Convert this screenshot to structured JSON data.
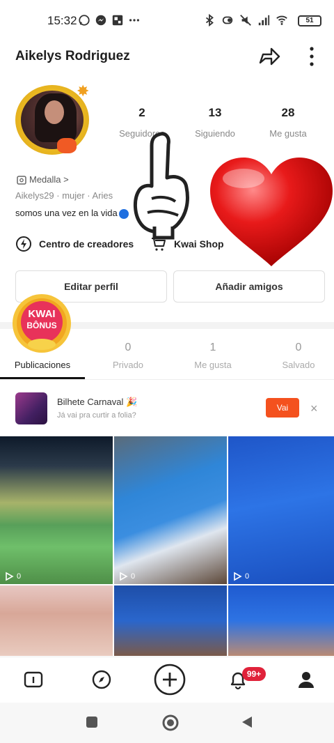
{
  "status": {
    "time": "15:32",
    "battery": "51"
  },
  "profile": {
    "name": "Aikelys Rodriguez",
    "stats": [
      {
        "num": "2",
        "label": "Seguidores"
      },
      {
        "num": "13",
        "label": "Siguiendo"
      },
      {
        "num": "28",
        "label": "Me gusta"
      }
    ],
    "medalla": "Medalla >",
    "meta": "Aikelys29  ·  mujer  ·  Aries",
    "bio": "somos una vez en la vida"
  },
  "links": {
    "creators": "Centro de creadores",
    "shop": "Kwai Shop"
  },
  "buttons": {
    "edit": "Editar perfil",
    "add_friends": "Añadir amigos"
  },
  "kwai_bonus": {
    "line1": "KWAI",
    "line2": "BÔNUS"
  },
  "tabs": [
    {
      "num": "",
      "label": "Publicaciones"
    },
    {
      "num": "0",
      "label": "Privado"
    },
    {
      "num": "1",
      "label": "Me gusta"
    },
    {
      "num": "0",
      "label": "Salvado"
    }
  ],
  "promo": {
    "title": "Bilhete Carnaval 🎉",
    "subtitle": "Já vai pra curtir a folia?",
    "button": "Vai",
    "close": "×"
  },
  "tiles": [
    {
      "plays": "0"
    },
    {
      "plays": "0"
    },
    {
      "plays": "0"
    }
  ],
  "nav": {
    "badge": "99+"
  },
  "colors": {
    "accent": "#f4511e",
    "badge": "#e0223a"
  }
}
